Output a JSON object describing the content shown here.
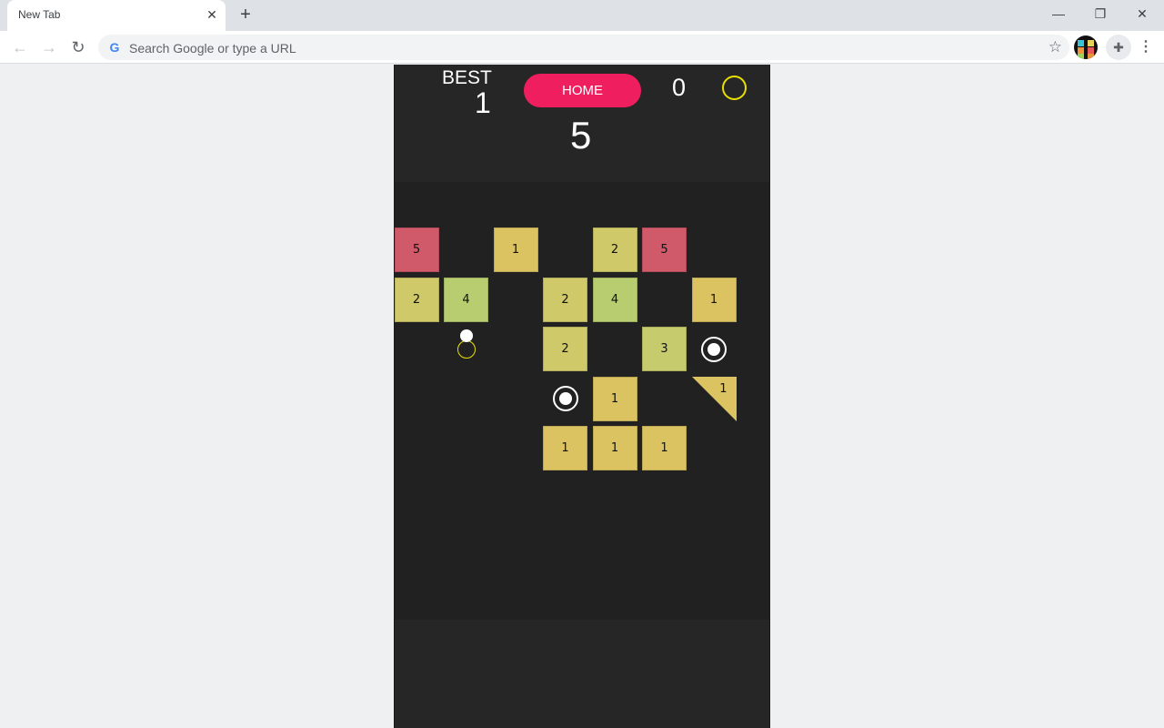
{
  "browser": {
    "tab_title": "New Tab",
    "omnibox_placeholder": "Search Google or type a URL"
  },
  "game": {
    "best_label": "BEST",
    "best_value": "1",
    "home_label": "HOME",
    "coins": "0",
    "level": "5",
    "colors": {
      "accent": "#ef1f5f",
      "coin": "#e8e000",
      "value_1": "#dbc362",
      "value_2": "#cfc96a",
      "value_3": "#c6cb6e",
      "value_4": "#b8cc70",
      "value_5": "#d05a6a"
    },
    "blocks": [
      {
        "row": 0,
        "col": 0,
        "value": "5",
        "shape": "square"
      },
      {
        "row": 0,
        "col": 2,
        "value": "1",
        "shape": "square"
      },
      {
        "row": 0,
        "col": 4,
        "value": "2",
        "shape": "square"
      },
      {
        "row": 0,
        "col": 5,
        "value": "5",
        "shape": "square"
      },
      {
        "row": 1,
        "col": 0,
        "value": "2",
        "shape": "square"
      },
      {
        "row": 1,
        "col": 1,
        "value": "4",
        "shape": "square"
      },
      {
        "row": 1,
        "col": 3,
        "value": "2",
        "shape": "square"
      },
      {
        "row": 1,
        "col": 4,
        "value": "4",
        "shape": "square"
      },
      {
        "row": 1,
        "col": 6,
        "value": "1",
        "shape": "square"
      },
      {
        "row": 2,
        "col": 3,
        "value": "2",
        "shape": "square"
      },
      {
        "row": 2,
        "col": 5,
        "value": "3",
        "shape": "square"
      },
      {
        "row": 3,
        "col": 4,
        "value": "1",
        "shape": "square"
      },
      {
        "row": 3,
        "col": 6,
        "value": "1",
        "shape": "triangle"
      },
      {
        "row": 4,
        "col": 3,
        "value": "1",
        "shape": "square"
      },
      {
        "row": 4,
        "col": 4,
        "value": "1",
        "shape": "square"
      },
      {
        "row": 4,
        "col": 5,
        "value": "1",
        "shape": "square"
      }
    ],
    "extra_balls": [
      {
        "row": 2,
        "col": 6
      },
      {
        "row": 3,
        "col": 3
      }
    ],
    "coins_on_board": [
      {
        "row": 2,
        "col": 1
      }
    ]
  }
}
